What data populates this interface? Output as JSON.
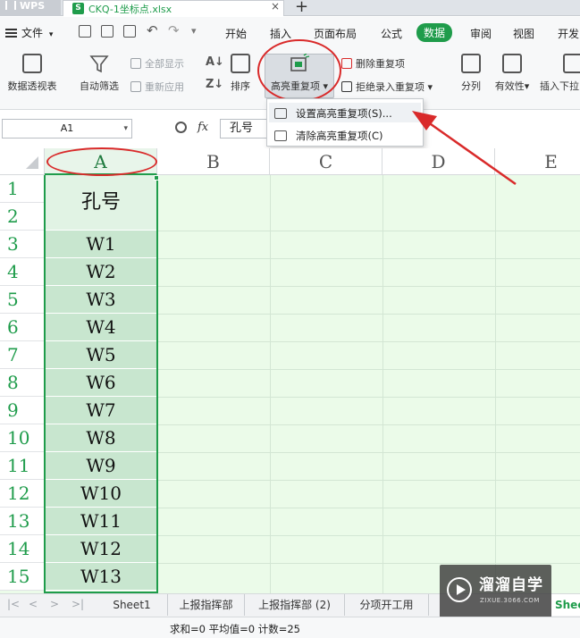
{
  "titlebar": {
    "app": "WPS",
    "document_tab": "CKQ-1坐标点.xlsx",
    "close_glyph": "×",
    "add_glyph": "+"
  },
  "menubar": {
    "file_label": "文件",
    "tabs": [
      "开始",
      "插入",
      "页面布局",
      "公式",
      "数据",
      "审阅",
      "视图",
      "开发"
    ],
    "active_tab": "数据",
    "accent_color": "#1f9c4b"
  },
  "ribbon": {
    "pivot_table": "数据透视表",
    "auto_filter": "自动筛选",
    "show_all": "全部显示",
    "reapply": "重新应用",
    "sort": "排序",
    "highlight_duplicates": "高亮重复项",
    "delete_duplicates": "删除重复项",
    "reject_duplicates": "拒绝录入重复项",
    "split_columns": "分列",
    "validity": "有效性",
    "insert_dropdown": "插入下拉"
  },
  "dropdown": {
    "items": [
      "设置高亮重复项(S)...",
      "清除高亮重复项(C)"
    ]
  },
  "formula_bar": {
    "name_box": "A1",
    "fx": "fx",
    "content": "孔号"
  },
  "grid": {
    "columns": [
      "A",
      "B",
      "C",
      "D",
      "E"
    ],
    "rows": [
      "1",
      "2",
      "3",
      "4",
      "5",
      "6",
      "7",
      "8",
      "9",
      "10",
      "11",
      "12",
      "13",
      "14",
      "15"
    ],
    "column_a": [
      "孔号",
      "W1",
      "W2",
      "W3",
      "W4",
      "W5",
      "W6",
      "W7",
      "W8",
      "W9",
      "W10",
      "W11",
      "W12",
      "W13"
    ]
  },
  "sheets": {
    "tabs": [
      "Sheet1",
      "上报指挥部",
      "上报指挥部 (2)",
      "分项开工用",
      "Shee"
    ],
    "active": "Shee"
  },
  "watermark": {
    "brand": "溜溜自学",
    "url": "ZIXUE.3066.COM"
  },
  "status": {
    "text": "求和=0   平均值=0   计数=25"
  },
  "annotation_color": "#d92a2a"
}
